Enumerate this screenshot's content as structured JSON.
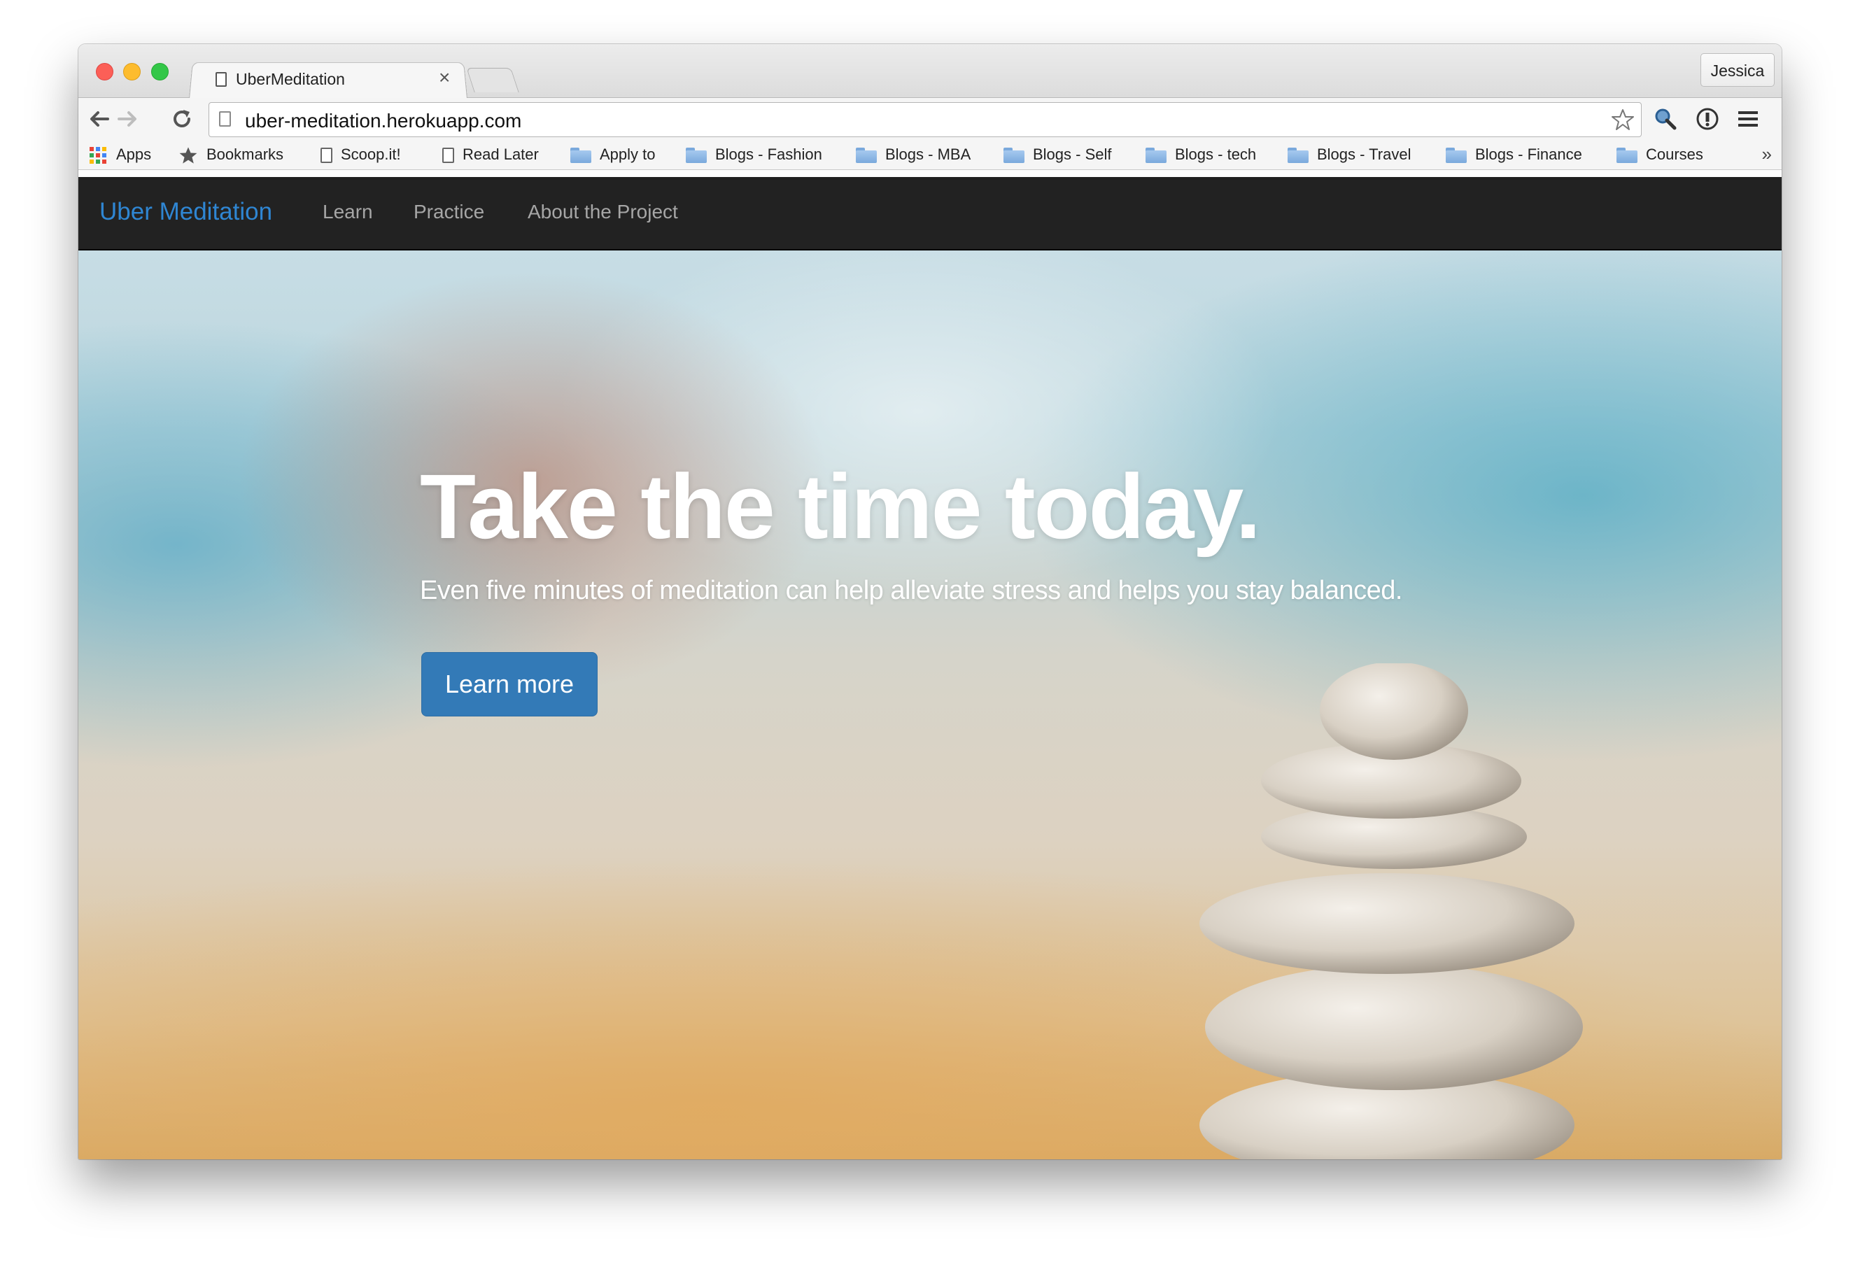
{
  "browser": {
    "tab_title": "UberMeditation",
    "tab_close": "×",
    "profile_name": "Jessica",
    "url": "uber-meditation.herokuapp.com",
    "bookmarks": [
      {
        "label": "Apps",
        "icon": "apps-grid-icon"
      },
      {
        "label": "Bookmarks",
        "icon": "star-icon"
      },
      {
        "label": "Scoop.it!",
        "icon": "page-icon"
      },
      {
        "label": "Read Later",
        "icon": "page-icon"
      },
      {
        "label": "Apply to",
        "icon": "folder-icon"
      },
      {
        "label": "Blogs - Fashion",
        "icon": "folder-icon"
      },
      {
        "label": "Blogs - MBA",
        "icon": "folder-icon"
      },
      {
        "label": "Blogs - Self",
        "icon": "folder-icon"
      },
      {
        "label": "Blogs - tech",
        "icon": "folder-icon"
      },
      {
        "label": "Blogs - Travel",
        "icon": "folder-icon"
      },
      {
        "label": "Blogs - Finance",
        "icon": "folder-icon"
      },
      {
        "label": "Courses",
        "icon": "folder-icon"
      }
    ],
    "bookmarks_overflow": "»"
  },
  "site": {
    "brand": "Uber Meditation",
    "nav": [
      "Learn",
      "Practice",
      "About the Project"
    ],
    "hero": {
      "title": "Take the time today.",
      "subtitle": "Even five minutes of meditation can help alleviate stress and helps you stay balanced.",
      "button": "Learn more"
    }
  },
  "colors": {
    "navbar_bg": "#222222",
    "brand": "#2f86d3",
    "nav_link": "#a6a6a6",
    "button": "#337ab7"
  }
}
